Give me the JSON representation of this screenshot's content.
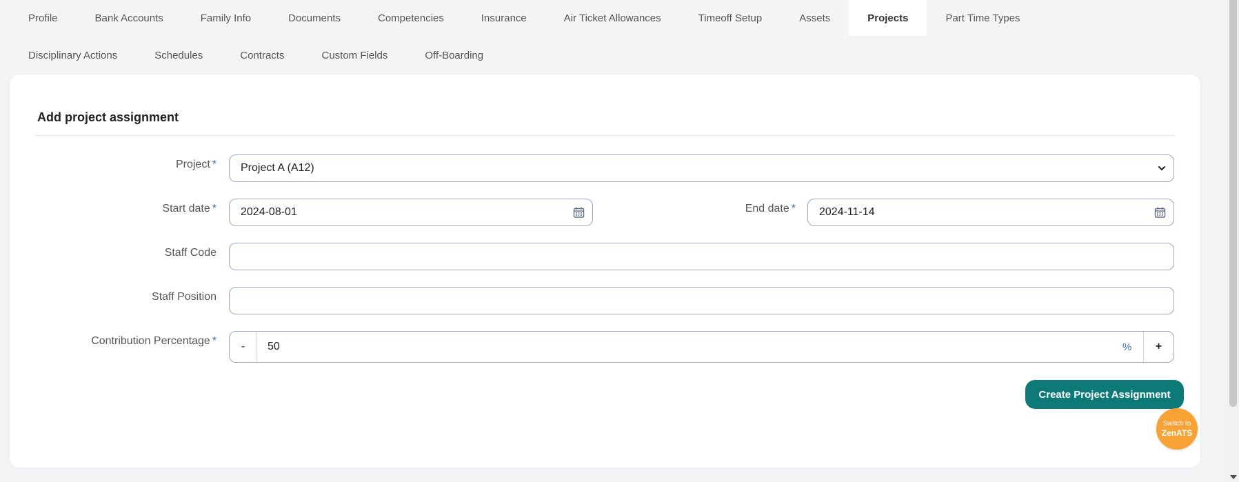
{
  "tabs": {
    "row1": [
      "Profile",
      "Bank Accounts",
      "Family Info",
      "Documents",
      "Competencies",
      "Insurance",
      "Air Ticket Allowances",
      "Timeoff Setup",
      "Assets",
      "Projects",
      "Part Time Types"
    ],
    "row2": [
      "Disciplinary Actions",
      "Schedules",
      "Contracts",
      "Custom Fields",
      "Off-Boarding"
    ],
    "active": "Projects"
  },
  "form": {
    "title": "Add project assignment",
    "project": {
      "label": "Project",
      "required_mark": "*",
      "value": "Project A (A12)",
      "icon": "chevron-down-icon"
    },
    "start_date": {
      "label": "Start date",
      "required_mark": "*",
      "value": "2024-08-01",
      "icon": "calendar-icon"
    },
    "end_date": {
      "label": "End date",
      "required_mark": "*",
      "value": "2024-11-14",
      "icon": "calendar-icon"
    },
    "staff_code": {
      "label": "Staff Code",
      "value": ""
    },
    "staff_position": {
      "label": "Staff Position",
      "value": ""
    },
    "contribution": {
      "label": "Contribution Percentage",
      "required_mark": "*",
      "value": "50",
      "unit": "%",
      "minus": "-",
      "plus": "+"
    },
    "submit_label": "Create Project Assignment"
  },
  "fab": {
    "line1": "Switch to",
    "line2": "ZenATS"
  },
  "colors": {
    "accent": "#0e7a78",
    "fab": "#f7a234",
    "required": "#3f6bb5",
    "border": "#98a8c8"
  }
}
